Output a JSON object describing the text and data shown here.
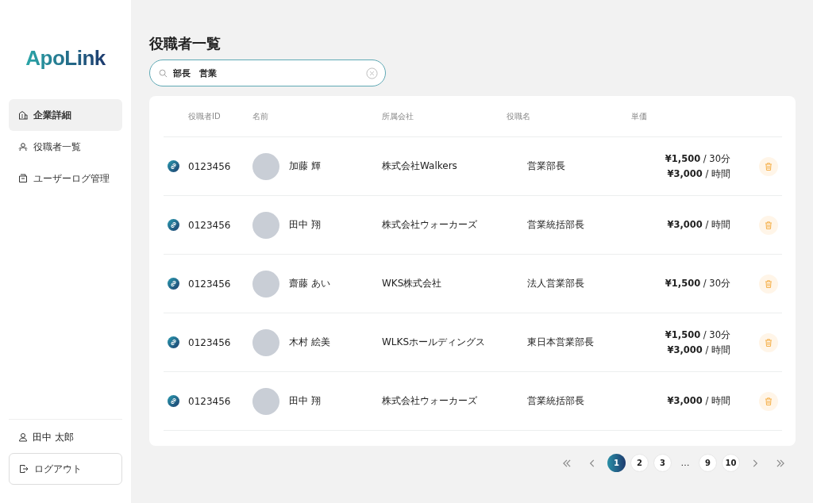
{
  "sidebar": {
    "logo": "ApoLink",
    "items": [
      {
        "label": "企業詳細",
        "kind": "building",
        "selected": true
      },
      {
        "label": "役職者一覧",
        "kind": "users",
        "selected": false
      },
      {
        "label": "ユーザーログ管理",
        "kind": "log",
        "selected": false
      }
    ],
    "user": "田中 太郎",
    "logout": "ログアウト"
  },
  "page_title": "役職者一覧",
  "search": {
    "value": "部長　営業"
  },
  "table": {
    "columns": [
      "役職者ID",
      "名前",
      "所属会社",
      "役職名",
      "単価"
    ],
    "rows": [
      {
        "id": "0123456",
        "name": "加藤 輝",
        "company": "株式会社Walkers",
        "role": "営業部長",
        "prices": [
          "**¥1,500** / 30分",
          "**¥3,000** / 時間"
        ]
      },
      {
        "id": "0123456",
        "name": "田中 翔",
        "company": "株式会社ウォーカーズ",
        "role": "営業統括部長",
        "prices": [
          "**¥3,000** / 時間"
        ]
      },
      {
        "id": "0123456",
        "name": "齋藤 あい",
        "company": "WKS株式会社",
        "role": "法人営業部長",
        "prices": [
          "**¥1,500** / 30分"
        ]
      },
      {
        "id": "0123456",
        "name": "木村 絵美",
        "company": "WLKSホールディングス",
        "role": "東日本営業部長",
        "prices": [
          "**¥1,500** / 30分",
          "**¥3,000** / 時間"
        ]
      },
      {
        "id": "0123456",
        "name": "田中 翔",
        "company": "株式会社ウォーカーズ",
        "role": "営業統括部長",
        "prices": [
          "**¥3,000** / 時間"
        ]
      }
    ]
  },
  "pagination": [
    {
      "kind": "page",
      "label": "1",
      "selected": true
    },
    {
      "kind": "page",
      "label": "2",
      "selected": false
    },
    {
      "kind": "page",
      "label": "3",
      "selected": false
    },
    {
      "kind": "gap",
      "label": "…"
    },
    {
      "kind": "page",
      "label": "9",
      "selected": false
    },
    {
      "kind": "page",
      "label": "10",
      "selected": false
    }
  ]
}
